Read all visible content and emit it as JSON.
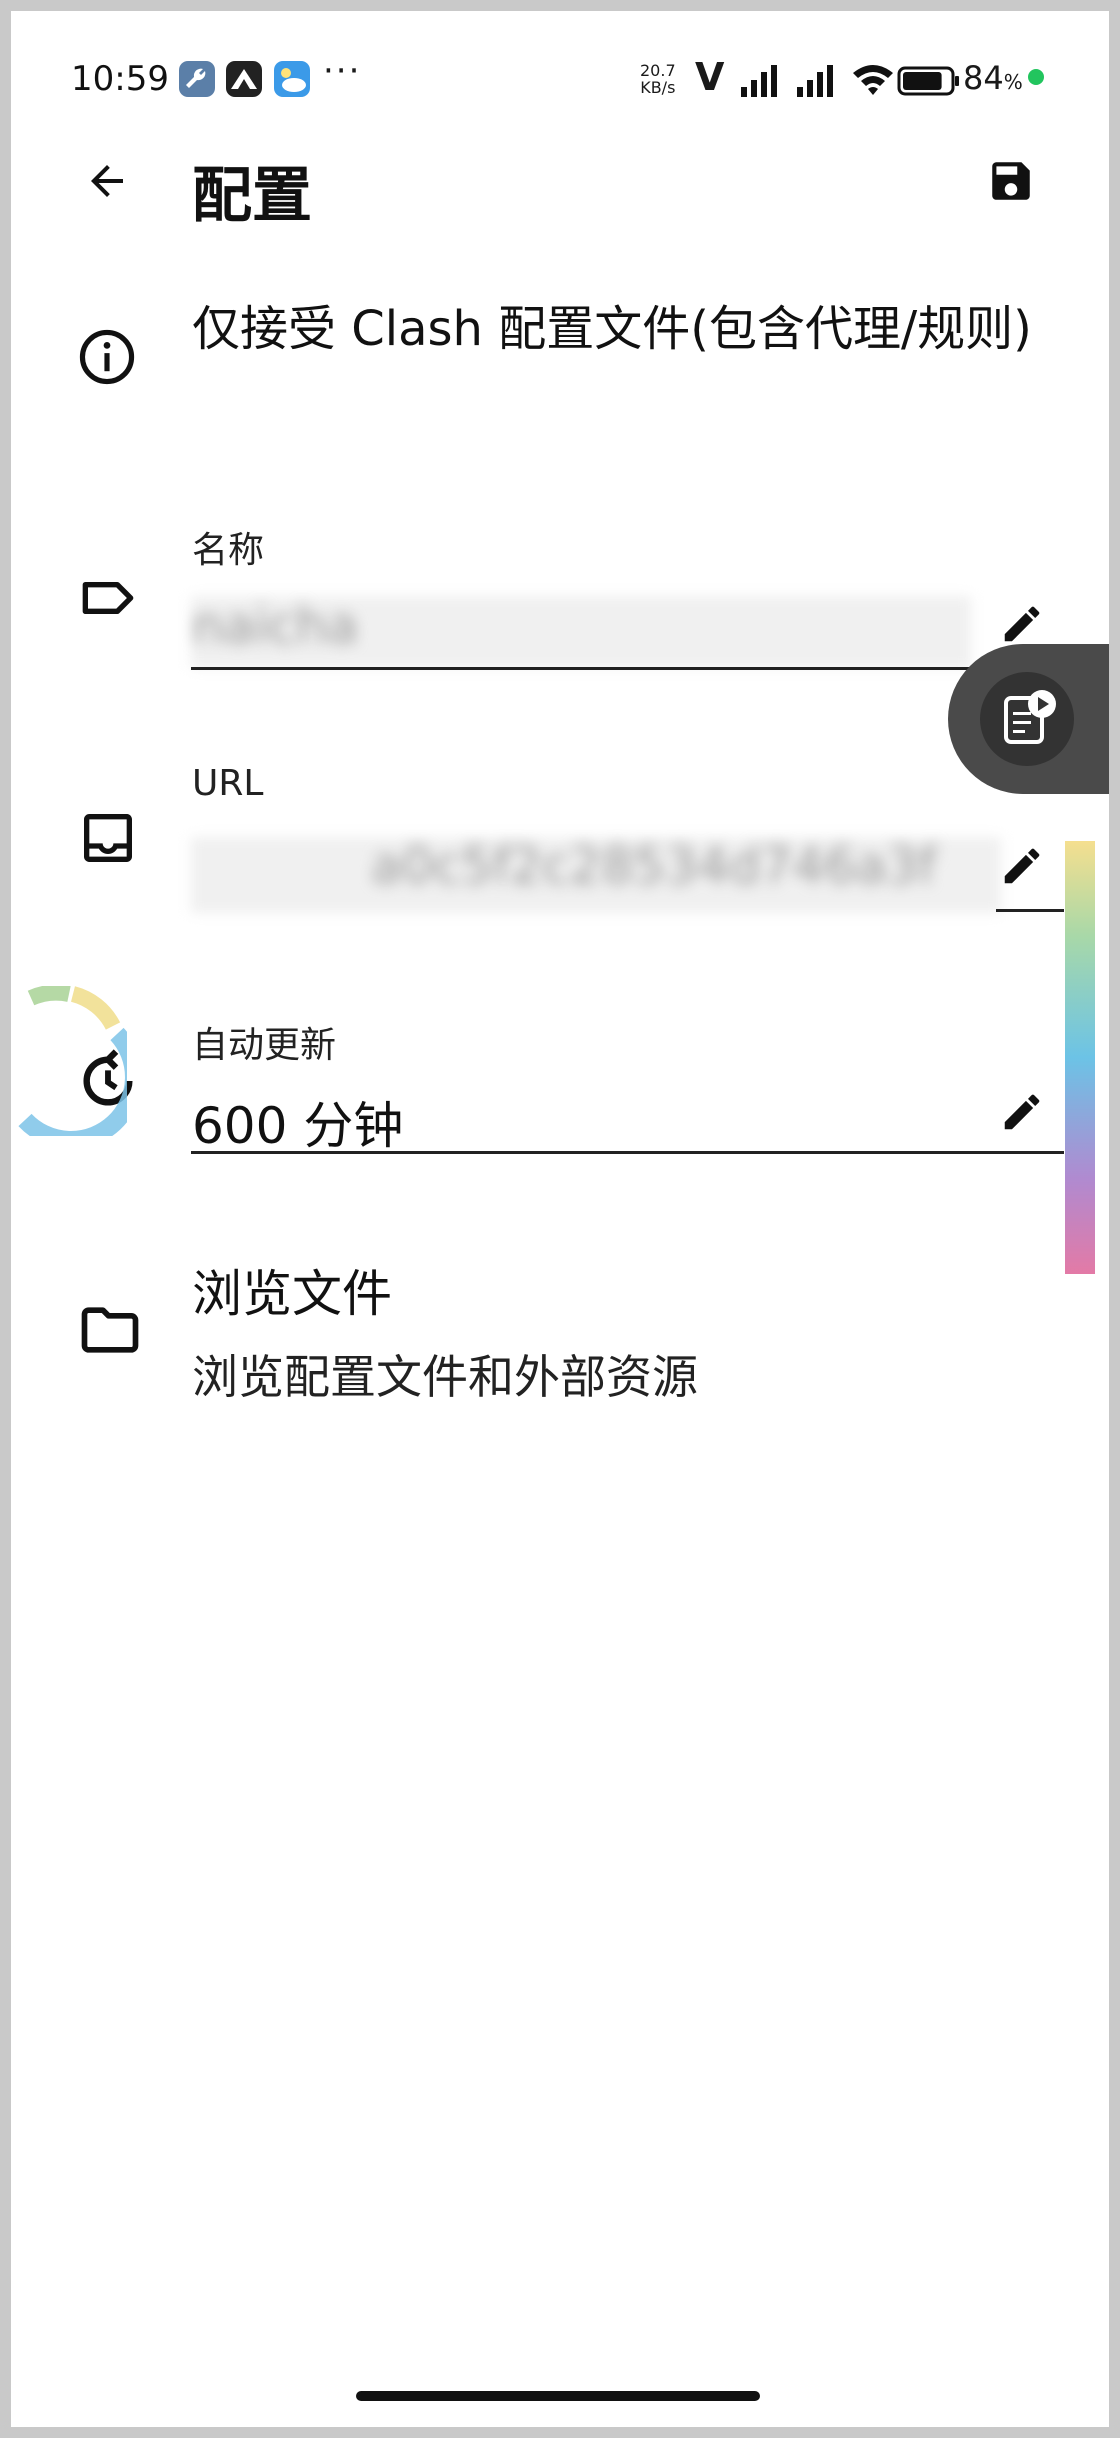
{
  "status_bar": {
    "time": "10:59",
    "more": "···",
    "net_speed_value": "20.7",
    "net_speed_unit": "KB/s",
    "carrier_mark": "V",
    "battery_percent": "84",
    "battery_unit": "%",
    "battery_level": 0.84,
    "notification_icons": [
      "wrench-app-icon",
      "mountain-app-icon",
      "weather-app-icon"
    ],
    "signal_icons": [
      "signal-icon",
      "signal-icon",
      "wifi-icon",
      "battery-icon"
    ],
    "status_dot_color": "#22c55e"
  },
  "app_bar": {
    "title": "配置",
    "back_icon": "arrow-left-icon",
    "save_icon": "floppy-save-icon"
  },
  "info": {
    "icon": "info-icon",
    "text": "仅接受 Clash 配置文件(包含代理/规则)"
  },
  "name_field": {
    "icon": "tag-icon",
    "label": "名称",
    "value": "naicha",
    "edit_icon": "pencil-icon"
  },
  "url_field": {
    "icon": "inbox-icon",
    "label": "URL",
    "value": "a0c5f2c28534d746a3f",
    "edit_icon": "pencil-icon"
  },
  "auto_update": {
    "icon": "refresh-clock-icon",
    "label": "自动更新",
    "value": "600 分钟",
    "edit_icon": "pencil-icon"
  },
  "browse": {
    "icon": "folder-icon",
    "title": "浏览文件",
    "subtitle": "浏览配置文件和外部资源"
  },
  "overlay": {
    "floating_icon": "screen-recorder-icon"
  }
}
